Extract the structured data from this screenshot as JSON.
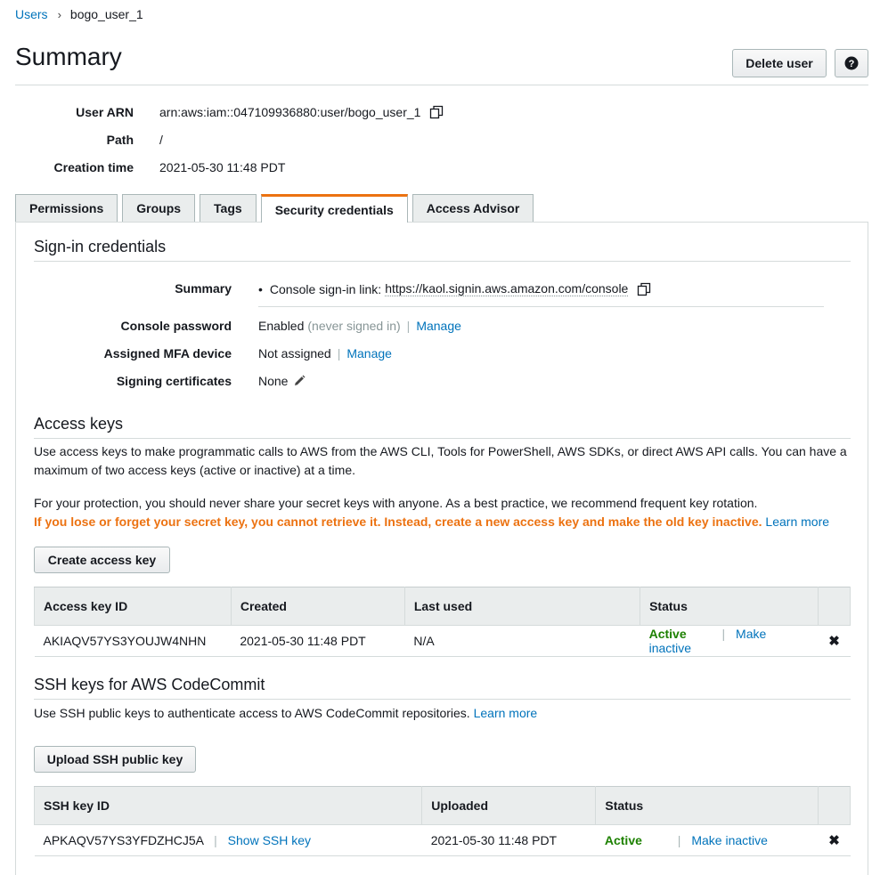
{
  "breadcrumb": {
    "parent": "Users",
    "current": "bogo_user_1"
  },
  "header": {
    "title": "Summary",
    "delete_label": "Delete user",
    "help_label": "?"
  },
  "summary": {
    "arn_label": "User ARN",
    "arn_value": "arn:aws:iam::047109936880:user/bogo_user_1",
    "path_label": "Path",
    "path_value": "/",
    "ctime_label": "Creation time",
    "ctime_value": "2021-05-30 11:48 PDT"
  },
  "tabs": [
    {
      "label": "Permissions"
    },
    {
      "label": "Groups"
    },
    {
      "label": "Tags"
    },
    {
      "label": "Security credentials"
    },
    {
      "label": "Access Advisor"
    }
  ],
  "signin": {
    "title": "Sign-in credentials",
    "summary_label": "Summary",
    "summary_prefix": "Console sign-in link:",
    "summary_link": "https://kaol.signin.aws.amazon.com/console",
    "password_label": "Console password",
    "password_status": "Enabled",
    "password_note": "(never signed in)",
    "manage": "Manage",
    "mfa_label": "Assigned MFA device",
    "mfa_value": "Not assigned",
    "certs_label": "Signing certificates",
    "certs_value": "None"
  },
  "access_keys": {
    "title": "Access keys",
    "para1": "Use access keys to make programmatic calls to AWS from the AWS CLI, Tools for PowerShell, AWS SDKs, or direct AWS API calls. You can have a maximum of two access keys (active or inactive) at a time.",
    "para2": "For your protection, you should never share your secret keys with anyone. As a best practice, we recommend frequent key rotation.",
    "warning": "If you lose or forget your secret key, you cannot retrieve it. Instead, create a new access key and make the old key inactive.",
    "learn_more": "Learn more",
    "create_button": "Create access key",
    "columns": [
      "Access key ID",
      "Created",
      "Last used",
      "Status"
    ],
    "rows": [
      {
        "id": "AKIAQV57YS3YOUJW4NHN",
        "created": "2021-05-30 11:48 PDT",
        "last_used": "N/A",
        "status": "Active",
        "action": "Make inactive"
      }
    ]
  },
  "ssh_keys": {
    "title": "SSH keys for AWS CodeCommit",
    "para": "Use SSH public keys to authenticate access to AWS CodeCommit repositories.",
    "learn_more": "Learn more",
    "upload_button": "Upload SSH public key",
    "columns": [
      "SSH key ID",
      "Uploaded",
      "Status"
    ],
    "rows": [
      {
        "id": "APKAQV57YS3YFDZHCJ5A",
        "show": "Show SSH key",
        "uploaded": "2021-05-30 11:48 PDT",
        "status": "Active",
        "action": "Make inactive"
      }
    ]
  },
  "colors": {
    "link": "#0073bb",
    "accent": "#ec7211",
    "active": "#1d8102"
  }
}
